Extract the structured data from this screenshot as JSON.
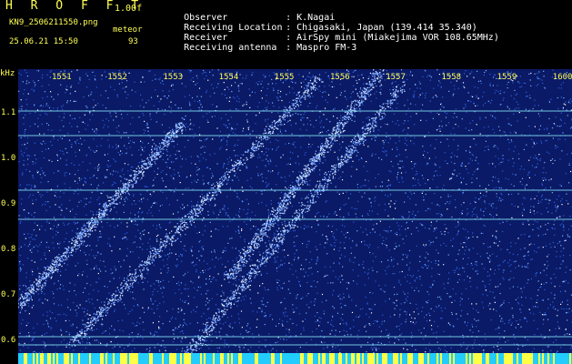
{
  "header": {
    "title": "H R O F F T",
    "version": "1.00f",
    "filename": "KN9_2506211550.png",
    "mode": "meteor",
    "datetime": "25.06.21 15:50",
    "count": "93"
  },
  "info": [
    {
      "label": "Observer",
      "value": "K.Nagai"
    },
    {
      "label": "Receiving Location",
      "value": "Chigasaki, Japan (139.414 35.340)"
    },
    {
      "label": "Receiver",
      "value": "AirSpy mini (Miakejima VOR 108.65MHz)"
    },
    {
      "label": "Receiving antenna",
      "value": "Maspro FM-3"
    }
  ],
  "axis": {
    "y_unit": "kHz",
    "y_ticks": [
      "1.1",
      "1.0",
      "0.9",
      "0.8",
      "0.7",
      "0.6"
    ],
    "x_ticks": [
      "1551",
      "1552",
      "1553",
      "1554",
      "1555",
      "1556",
      "1557",
      "1558",
      "1559",
      "1600"
    ]
  },
  "colors": {
    "background": "#000000",
    "plot": "#0a1a66",
    "label": "#ffff55",
    "noise": "#4a7cff",
    "line": "#8ff0ff"
  }
}
